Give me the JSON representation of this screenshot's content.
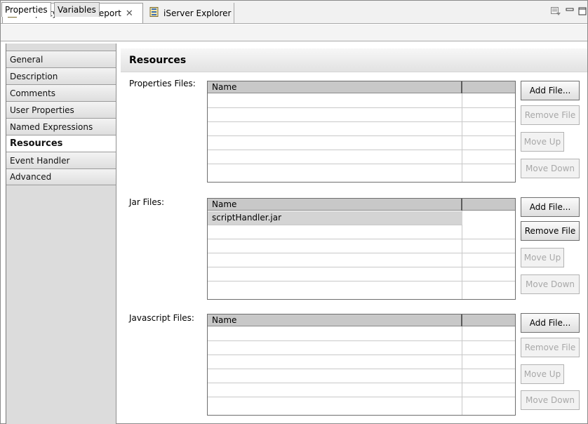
{
  "tabs": {
    "property_editor": "Property Editor - Report",
    "iserver": "iServer Explorer"
  },
  "subtabs": [
    "Properties",
    "Variables"
  ],
  "nav": [
    "General",
    "Description",
    "Comments",
    "User Properties",
    "Named Expressions",
    "Resources",
    "Event Handler",
    "Advanced"
  ],
  "section_title": "Resources",
  "properties_files": {
    "label": "Properties Files:",
    "column": "Name",
    "rows": []
  },
  "jar_files": {
    "label": "Jar Files:",
    "column": "Name",
    "rows": [
      "scriptHandler.jar"
    ]
  },
  "javascript_files": {
    "label": "Javascript Files:",
    "column": "Name",
    "rows": []
  },
  "buttons": {
    "add": "Add File...",
    "remove": "Remove File",
    "move_up": "Move Up",
    "move_down": "Move Down"
  },
  "icons": {
    "property_editor": "property-editor-icon",
    "iserver": "iserver-explorer-icon",
    "close": "close-icon",
    "view_menu": "view-menu-icon",
    "minimize": "minimize-icon",
    "maximize": "maximize-icon"
  },
  "colors": {
    "nav_bg": "#dcdcdc",
    "header_gray": "#c8c8c8",
    "disabled_text": "#a8a8a8"
  }
}
